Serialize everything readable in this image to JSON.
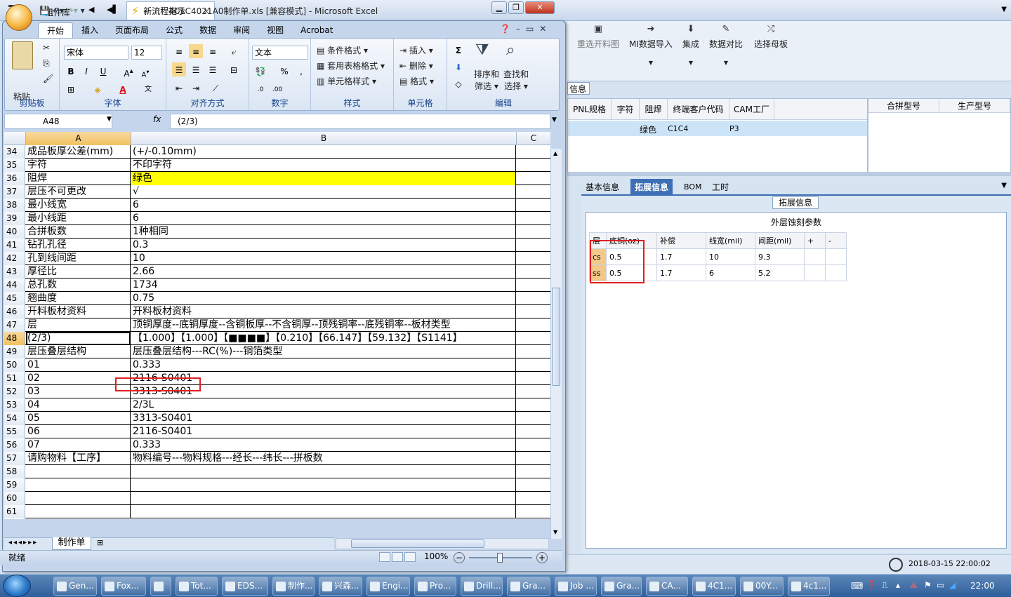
{
  "background_app": {
    "component_library": "组件库",
    "tab_title": "新流程指示",
    "toolbar": [
      {
        "label": "重选开料图",
        "icon": "image-icon"
      },
      {
        "label": "MI数据导入",
        "icon": "import-icon"
      },
      {
        "label": "集成",
        "icon": "download-icon"
      },
      {
        "label": "数据对比",
        "icon": "compare-icon"
      },
      {
        "label": "选择母板",
        "icon": "shuffle-icon"
      }
    ],
    "info_label": "信息",
    "grid1": {
      "headers": [
        "PNL规格",
        "字符",
        "阻焊",
        "终端客户代码",
        "CAM工厂"
      ],
      "row": {
        "solder": "绿色",
        "customer": "C1C4",
        "factory": "P3"
      }
    },
    "grid2": {
      "headers": [
        "合拼型号",
        "生产型号"
      ]
    },
    "detail_tabs": [
      "基本信息",
      "拓展信息",
      "BOM",
      "工时"
    ],
    "active_detail_tab": "拓展信息",
    "ext_legend": "拓展信息",
    "ext_title": "外层蚀刻参数",
    "ext_table": {
      "headers": [
        "层",
        "底铜(oz)",
        "补偿",
        "线宽(mil)",
        "间距(mil)",
        "+",
        "-"
      ],
      "rows": [
        [
          "cs",
          "0.5",
          "1.7",
          "10",
          "9.3",
          "",
          ""
        ],
        [
          "ss",
          "0.5",
          "1.7",
          "6",
          "5.2",
          "",
          ""
        ]
      ]
    },
    "timestamp": "2018-03-15 22:00:02"
  },
  "excel": {
    "title": "4C1C4021A0制作单.xls  [兼容模式] - Microsoft Excel",
    "ribbon_tabs": [
      "开始",
      "插入",
      "页面布局",
      "公式",
      "数据",
      "审阅",
      "视图",
      "Acrobat"
    ],
    "active_tab": "开始",
    "ribbon": {
      "clipboard": {
        "paste": "粘贴",
        "label": "剪贴板"
      },
      "font": {
        "name": "宋体",
        "size": "12",
        "label": "字体"
      },
      "alignment": {
        "label": "对齐方式"
      },
      "number": {
        "format": "文本",
        "label": "数字",
        "percent": "%",
        "comma": ","
      },
      "styles": {
        "conditional": "条件格式",
        "table": "套用表格格式",
        "cell": "单元格样式",
        "label": "样式"
      },
      "cells": {
        "insert": "插入",
        "delete": "删除",
        "format": "格式",
        "label": "单元格"
      },
      "editing": {
        "sort": "排序和",
        "filter": "筛选",
        "find": "查找和",
        "select": "选择",
        "label": "编辑"
      }
    },
    "name_box": "A48",
    "formula": "(2/3)",
    "columns": [
      "A",
      "B",
      "C"
    ],
    "rows": [
      {
        "n": "34",
        "a": "成品板厚公差(mm)",
        "b": "(+/-0.10mm)"
      },
      {
        "n": "35",
        "a": "字符",
        "b": "不印字符"
      },
      {
        "n": "36",
        "a": "阻焊",
        "b": "绿色",
        "yellow": true
      },
      {
        "n": "37",
        "a": "层压不可更改",
        "b": "√"
      },
      {
        "n": "38",
        "a": "最小线宽",
        "b": "6"
      },
      {
        "n": "39",
        "a": "最小线距",
        "b": "6"
      },
      {
        "n": "40",
        "a": "合拼板数",
        "b": "1种相同"
      },
      {
        "n": "41",
        "a": "钻孔孔径",
        "b": "0.3"
      },
      {
        "n": "42",
        "a": "孔到线间距",
        "b": "10"
      },
      {
        "n": "43",
        "a": "厚径比",
        "b": "2.66"
      },
      {
        "n": "44",
        "a": "总孔数",
        "b": "1734"
      },
      {
        "n": "45",
        "a": "翘曲度",
        "b": "0.75"
      },
      {
        "n": "46",
        "a": "开料板材资料",
        "b": "开料板材资料"
      },
      {
        "n": "47",
        "a": "层",
        "b": "顶铜厚度--底铜厚度--含铜板厚--不含铜厚--顶残铜率--底残铜率--板材类型"
      },
      {
        "n": "48",
        "a": "(2/3)",
        "b": "【1.000】【1.000】【■■■■】【0.210】【66.147】【59.132】【S1141】",
        "selected": true
      },
      {
        "n": "49",
        "a": "层压叠层结构",
        "b": "层压叠层结构---RC(%)---铜箔类型"
      },
      {
        "n": "50",
        "a": "01",
        "b": "0.333"
      },
      {
        "n": "51",
        "a": "02",
        "b": "2116-S0401"
      },
      {
        "n": "52",
        "a": "03",
        "b": "3313-S0401"
      },
      {
        "n": "53",
        "a": "04",
        "b": "2/3L"
      },
      {
        "n": "54",
        "a": "05",
        "b": "3313-S0401"
      },
      {
        "n": "55",
        "a": "06",
        "b": "2116-S0401"
      },
      {
        "n": "56",
        "a": "07",
        "b": "0.333"
      },
      {
        "n": "57",
        "a": "请购物料【工序】",
        "b": "物料编号---物料规格---经长---纬长---拼板数"
      },
      {
        "n": "58",
        "a": "",
        "b": ""
      },
      {
        "n": "59",
        "a": "",
        "b": ""
      },
      {
        "n": "60",
        "a": "",
        "b": ""
      },
      {
        "n": "61",
        "a": "",
        "b": ""
      }
    ],
    "sheet_tab": "制作单",
    "status": "就绪",
    "zoom": "100%"
  },
  "taskbar": {
    "items": [
      "Gen...",
      "Fox...",
      "",
      "Tot...",
      "EDS...",
      "制作...",
      "兴森...",
      "Engi...",
      "Pro...",
      "Drill...",
      "Gra...",
      "Job ...",
      "Gra...",
      "CA...",
      "4C1...",
      "00Y...",
      "4c1..."
    ],
    "time": "22:00"
  }
}
